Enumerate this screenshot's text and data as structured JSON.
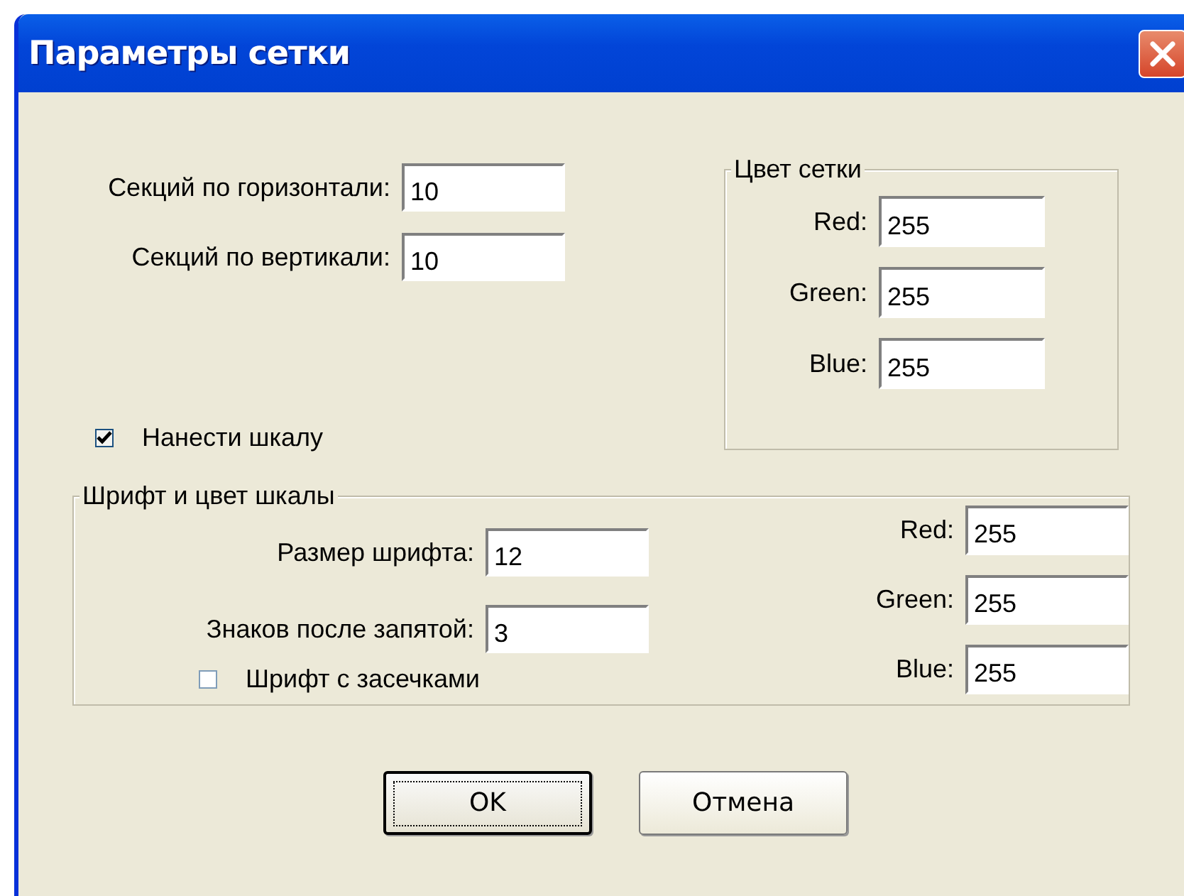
{
  "window": {
    "title": "Параметры сетки"
  },
  "grid": {
    "fields": [
      {
        "label": "Секций по горизонтали:",
        "value": "10"
      },
      {
        "label": "Секций по вертикали:",
        "value": "10"
      }
    ]
  },
  "grid_color": {
    "title": "Цвет сетки",
    "fields": [
      {
        "label": "Red:",
        "value": "255"
      },
      {
        "label": "Green:",
        "value": "255"
      },
      {
        "label": "Blue:",
        "value": "255"
      }
    ]
  },
  "show_scale": {
    "label": "Нанести шкалу",
    "checked": true
  },
  "scale_font": {
    "title": "Шрифт и цвет шкалы",
    "fields": [
      {
        "label": "Размер шрифта:",
        "value": "12"
      },
      {
        "label": "Знаков после запятой:",
        "value": "3"
      }
    ],
    "serif": {
      "label": "Шрифт с засечками",
      "checked": false
    },
    "color_fields": [
      {
        "label": "Red:",
        "value": "255"
      },
      {
        "label": "Green:",
        "value": "255"
      },
      {
        "label": "Blue:",
        "value": "255"
      }
    ]
  },
  "buttons": [
    {
      "label": "OK",
      "default": true
    },
    {
      "label": "Отмена",
      "default": false
    }
  ]
}
